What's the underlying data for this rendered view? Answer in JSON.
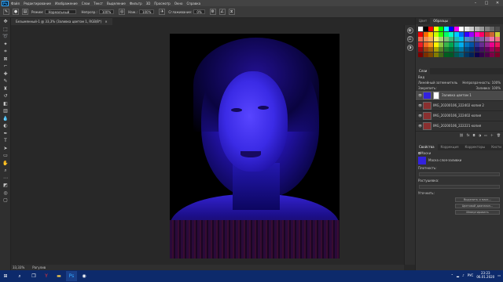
{
  "menubar": {
    "logo": "Ps",
    "items": [
      "Файл",
      "Редактирование",
      "Изображение",
      "Слои",
      "Текст",
      "Выделение",
      "Фильтр",
      "3D",
      "Просмотр",
      "Окно",
      "Справка"
    ],
    "minimize": "–",
    "maximize": "□",
    "close": "✕"
  },
  "options": {
    "mode_label": "Режим:",
    "mode_value": "Нормальный",
    "opacity_label": "Непрозр.:",
    "opacity_value": "100%",
    "pressure_label": "Наж.:",
    "pressure_value": "100%",
    "smooth_label": "Сглаживание:",
    "smooth_value": "0%"
  },
  "document_tab": {
    "title": "Безымянный-1 @ 33,3% (Заливка цветом 1, RGB/8*)",
    "close": "×"
  },
  "swatches": {
    "tabs": [
      "Цвет",
      "Образцы"
    ],
    "colors": [
      "#ffffff",
      "#000000",
      "#ff0000",
      "#ffff00",
      "#00ff00",
      "#00ffff",
      "#0000ff",
      "#ff00ff",
      "#ffffff",
      "#e6e6e6",
      "#cccccc",
      "#b3b3b3",
      "#999999",
      "#808080",
      "#666666",
      "#4d4d4d",
      "#f00000",
      "#ff6600",
      "#ffcc00",
      "#ccff00",
      "#33ff00",
      "#00ff66",
      "#00ffcc",
      "#00ccff",
      "#0066ff",
      "#3300ff",
      "#9900ff",
      "#ff00cc",
      "#ff0066",
      "#cc3333",
      "#cc6633",
      "#cccc33",
      "#f26c4f",
      "#f68e55",
      "#fbaf5c",
      "#fff467",
      "#acd372",
      "#7cc576",
      "#3bb878",
      "#1abbb4",
      "#00bff3",
      "#438ccb",
      "#5574b9",
      "#605ca8",
      "#855fa8",
      "#a763a8",
      "#f06ea9",
      "#f26d7d",
      "#ed1c24",
      "#f26522",
      "#f7941d",
      "#fff200",
      "#8dc73f",
      "#39b54a",
      "#00a651",
      "#00a99d",
      "#00aeef",
      "#0072bc",
      "#0054a6",
      "#2e3192",
      "#662d91",
      "#92278f",
      "#ec008c",
      "#ed145b",
      "#9e0b0f",
      "#a0410d",
      "#a36209",
      "#aba000",
      "#598527",
      "#1a7b30",
      "#007236",
      "#00746b",
      "#0076a3",
      "#004b80",
      "#003471",
      "#1b1464",
      "#440e62",
      "#630460",
      "#9e005d",
      "#9e0039",
      "#790000",
      "#7b2e00",
      "#7d4900",
      "#827b00",
      "#406618",
      "#005e20",
      "#005826",
      "#005952",
      "#005b7f",
      "#003663",
      "#002157",
      "#0d004c",
      "#32004b",
      "#4b0049",
      "#7b0046",
      "#7a0026"
    ]
  },
  "layers": {
    "tabs": [
      "Слои"
    ],
    "filter_label": "Вид",
    "blend_mode": "Линейный затемнитель",
    "opacity_label": "Непрозрачность:",
    "opacity_value": "100%",
    "lock_label": "Закрепить:",
    "fill_label": "Заливка:",
    "fill_value": "100%",
    "items": [
      {
        "name": "Заливка цветом 1",
        "thumb": "#3322dd",
        "mask": true
      },
      {
        "name": "IMG_20200106_222402 копия 2",
        "thumb": "#8a3030",
        "mask": false
      },
      {
        "name": "IMG_20200106_222402 копия",
        "thumb": "#8a3030",
        "mask": false
      },
      {
        "name": "IMG_20200106_222221 копия",
        "thumb": "#8a3030",
        "mask": false
      }
    ]
  },
  "properties": {
    "tabs": [
      "Свойства",
      "Коррекция",
      "Корректоры",
      "Кисти"
    ],
    "section": "Маски",
    "layer_label": "Маска слоя-заливки",
    "density_label": "Плотность:",
    "feather_label": "Растушевка:",
    "refine_label": "Уточнить:",
    "btn1": "Выделить и маск...",
    "btn2": "Цветовой диапазон...",
    "btn3": "Инвертировать"
  },
  "status": {
    "zoom": "33,33%",
    "info": "Рагулив"
  },
  "taskbar": {
    "start": "⊞",
    "search": "⌕",
    "lang": "РУС",
    "time": "23:23",
    "date": "06.01.2020"
  }
}
